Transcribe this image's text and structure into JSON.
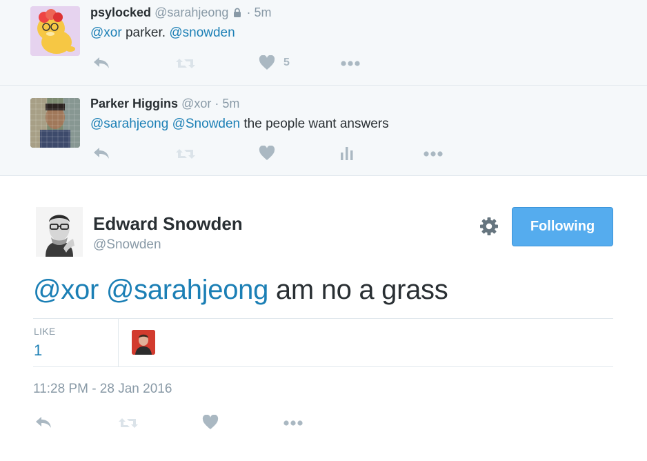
{
  "replies": [
    {
      "name": "psylocked",
      "handle": "@sarahjeong",
      "separator": "·",
      "time": "5m",
      "text_parts": [
        "@xor",
        " parker. ",
        "@snowden"
      ],
      "like_count": "5"
    },
    {
      "name": "Parker Higgins",
      "handle": "@xor",
      "separator": "·",
      "time": "5m",
      "text_parts": [
        "@sarahjeong",
        " ",
        "@Snowden",
        " the people want answers"
      ]
    }
  ],
  "main_tweet": {
    "name": "Edward Snowden",
    "handle": "@Snowden",
    "follow_label": "Following",
    "text_parts": [
      "@xor",
      " ",
      "@sarahjeong",
      " am no a grass"
    ],
    "stats": {
      "like_label": "LIKE",
      "like_value": "1"
    },
    "timestamp": "11:28 PM - 28 Jan 2016"
  },
  "colors": {
    "mention": "#1b7fb5",
    "follow_button": "#55acee",
    "muted": "#8899a6",
    "icon": "#aab8c2"
  },
  "icons": [
    "lock-icon",
    "reply-icon",
    "retweet-icon",
    "heart-icon",
    "analytics-icon",
    "more-icon",
    "gear-icon"
  ]
}
